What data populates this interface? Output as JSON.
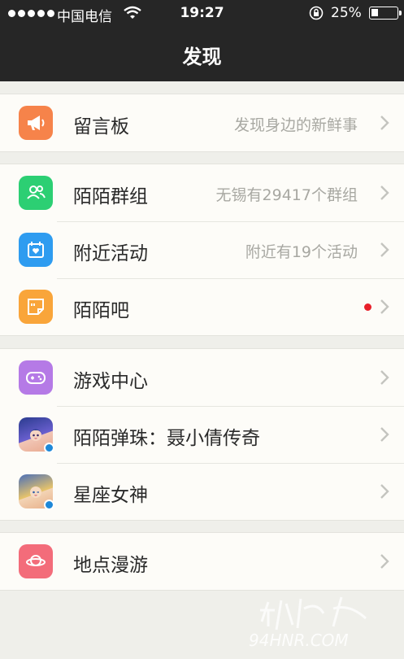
{
  "status_bar": {
    "carrier": "中国电信",
    "time": "19:27",
    "battery": "25%"
  },
  "header": {
    "title": "发现"
  },
  "groups": [
    {
      "items": [
        {
          "label": "留言板",
          "detail": "发现身边的新鲜事",
          "icon": "megaphone-icon",
          "color": "#f6834a"
        }
      ]
    },
    {
      "items": [
        {
          "label": "陌陌群组",
          "detail": "无锡有29417个群组",
          "icon": "people-icon",
          "color": "#2ccf73"
        },
        {
          "label": "附近活动",
          "detail": "附近有19个活动",
          "icon": "calendar-heart-icon",
          "color": "#2e9cf0"
        },
        {
          "label": "陌陌吧",
          "detail": "",
          "icon": "note-icon",
          "color": "#f9a53a",
          "has_new": true
        }
      ]
    },
    {
      "items": [
        {
          "label": "游戏中心",
          "detail": "",
          "icon": "gamepad-icon",
          "color": "#b57ae6"
        },
        {
          "label": "陌陌弹珠：聂小倩传奇",
          "detail": "",
          "icon": "game-avatar-icon",
          "color": "#3a4fa8"
        },
        {
          "label": "星座女神",
          "detail": "",
          "icon": "game-avatar-icon",
          "color": "#d8b259"
        }
      ]
    },
    {
      "items": [
        {
          "label": "地点漫游",
          "detail": "",
          "icon": "planet-icon",
          "color": "#f36c7a"
        }
      ]
    }
  ],
  "watermark": "94HNR.COM"
}
